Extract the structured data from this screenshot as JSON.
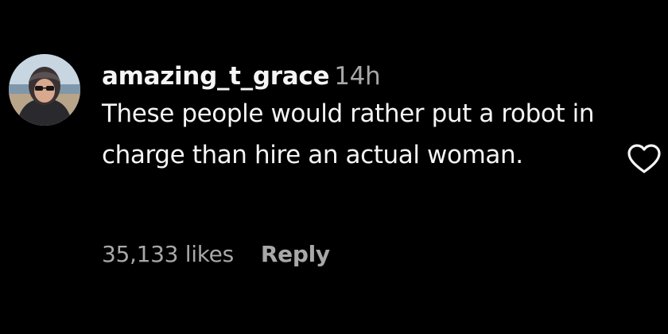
{
  "comment": {
    "username": "amazing_t_grace",
    "time": "14h",
    "text": "These people would rather put a robot in charge than hire an actual woman.",
    "likes": "35,133 likes",
    "reply_label": "Reply"
  },
  "icons": {
    "like": "heart-outline-icon",
    "avatar": "user-avatar-photo"
  },
  "colors": {
    "background": "#000000",
    "primary_text": "#f5f5f5",
    "secondary_text": "#a8a8a8"
  }
}
